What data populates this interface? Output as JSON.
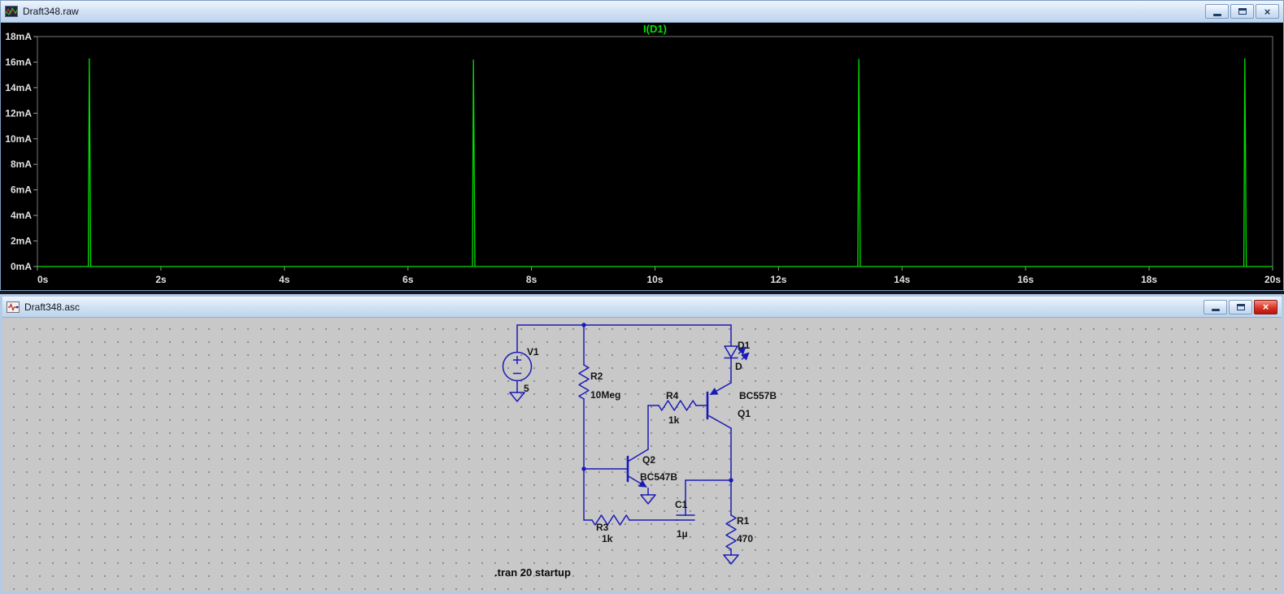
{
  "windows": {
    "plot": {
      "title": "Draft348.raw",
      "close_glyph": "×"
    },
    "schematic": {
      "title": "Draft348.asc",
      "close_glyph": "×"
    }
  },
  "schematic": {
    "directive": ".tran 20 startup",
    "wire_color": "#1a1ab8",
    "canvas_color": "#c8c8c8",
    "components": {
      "V1": {
        "designator": "V1",
        "value": "5"
      },
      "R1": {
        "designator": "R1",
        "value": "470"
      },
      "R2": {
        "designator": "R2",
        "value": "10Meg"
      },
      "R3": {
        "designator": "R3",
        "value": "1k"
      },
      "R4": {
        "designator": "R4",
        "value": "1k"
      },
      "C1": {
        "designator": "C1",
        "value": "1µ"
      },
      "D1": {
        "designator": "D1",
        "value": "D"
      },
      "Q1": {
        "designator": "Q1",
        "value": "BC557B"
      },
      "Q2": {
        "designator": "Q2",
        "value": "BC547B"
      }
    }
  },
  "chart_data": {
    "type": "line",
    "title": "I(D1)",
    "legend": [
      "I(D1)"
    ],
    "legend_position": "top-center",
    "x_unit": "s",
    "y_unit": "mA",
    "xlim": [
      0,
      20
    ],
    "ylim": [
      0,
      18
    ],
    "x_tick_step": 2,
    "y_tick_step": 2,
    "x_ticks": [
      "0s",
      "2s",
      "4s",
      "6s",
      "8s",
      "10s",
      "12s",
      "14s",
      "16s",
      "18s",
      "20s"
    ],
    "y_ticks": [
      "18mA",
      "16mA",
      "14mA",
      "12mA",
      "10mA",
      "8mA",
      "6mA",
      "4mA",
      "2mA",
      "0mA"
    ],
    "grid": false,
    "background": "#000000",
    "trace_color": "#00e000",
    "axis_text_color": "#e0e0e0",
    "baseline_mA": 0,
    "spikes": [
      {
        "t_s": 0.84,
        "peak_mA": 16.3
      },
      {
        "t_s": 7.06,
        "peak_mA": 16.2
      },
      {
        "t_s": 13.3,
        "peak_mA": 16.25
      },
      {
        "t_s": 19.55,
        "peak_mA": 16.3
      }
    ]
  }
}
